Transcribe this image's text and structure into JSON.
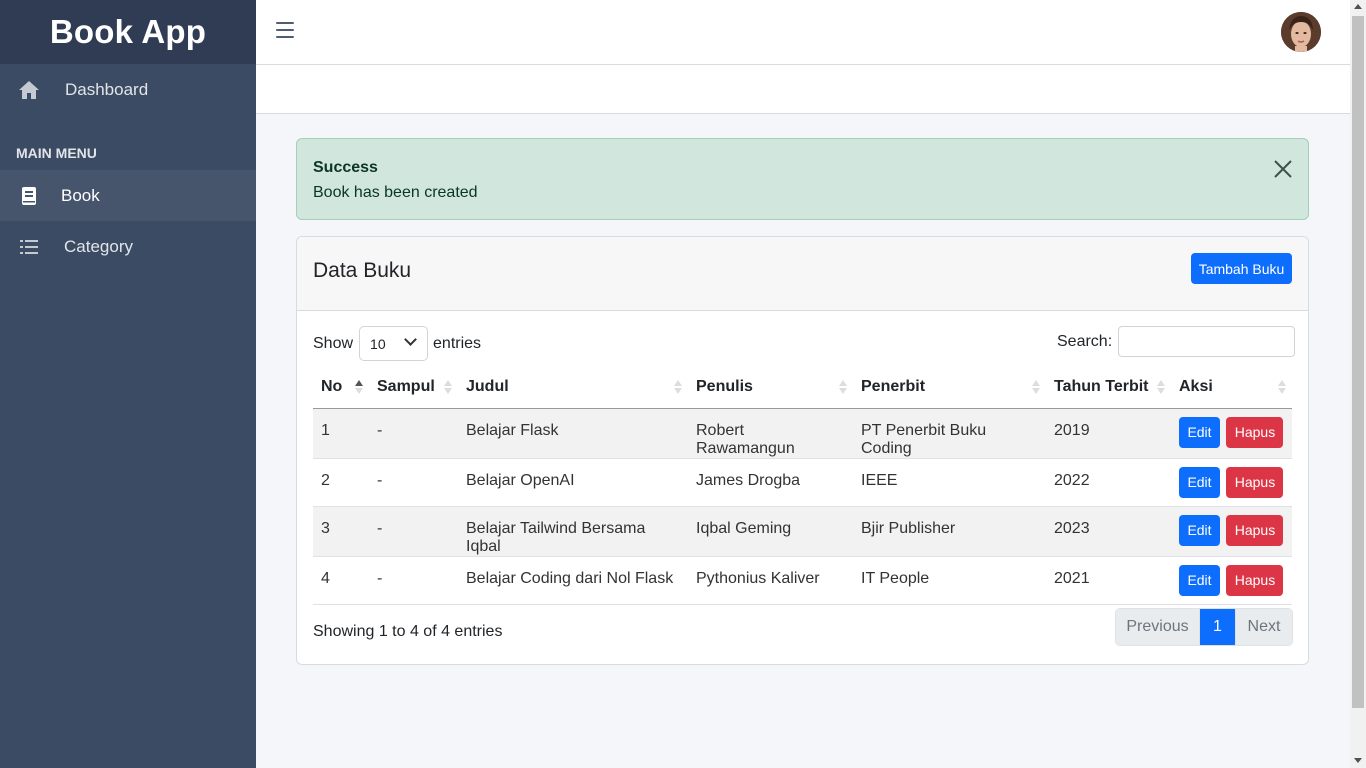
{
  "sidebar": {
    "brand": "Book App",
    "dashboard_label": "Dashboard",
    "section_title": "MAIN MENU",
    "items": [
      {
        "label": "Book",
        "icon": "book-icon",
        "active": true
      },
      {
        "label": "Category",
        "icon": "list-icon",
        "active": false
      }
    ]
  },
  "header": {
    "toggle_icon": "hamburger-icon",
    "avatar": "user-avatar"
  },
  "alert": {
    "heading": "Success",
    "message": "Book has been created",
    "close_icon": "close-icon",
    "color": "#d1e7dd"
  },
  "card": {
    "title": "Data Buku",
    "add_button": "Tambah Buku"
  },
  "datatable": {
    "show_label": "Show",
    "page_size": "10",
    "entries_label": "entries",
    "search_label": "Search:",
    "search_value": "",
    "columns": [
      "No",
      "Sampul",
      "Judul",
      "Penulis",
      "Penerbit",
      "Tahun Terbit",
      "Aksi"
    ],
    "rows": [
      {
        "no": "1",
        "sampul": "-",
        "judul": "Belajar Flask",
        "penulis": "Robert Rawamangun",
        "penerbit": "PT Penerbit Buku Coding",
        "tahun": "2019"
      },
      {
        "no": "2",
        "sampul": "-",
        "judul": "Belajar OpenAI",
        "penulis": "James Drogba",
        "penerbit": "IEEE",
        "tahun": "2022"
      },
      {
        "no": "3",
        "sampul": "-",
        "judul": "Belajar Tailwind Bersama Iqbal",
        "penulis": "Iqbal Geming",
        "penerbit": "Bjir Publisher",
        "tahun": "2023"
      },
      {
        "no": "4",
        "sampul": "-",
        "judul": "Belajar Coding dari Nol Flask",
        "penulis": "Pythonius Kaliver",
        "penerbit": "IT People",
        "tahun": "2021"
      }
    ],
    "edit_label": "Edit",
    "delete_label": "Hapus",
    "info": "Showing 1 to 4 of 4 entries",
    "pagination": {
      "previous": "Previous",
      "current": "1",
      "next": "Next"
    }
  },
  "colors": {
    "sidebar_bg": "#3c4b64",
    "brand_bg": "#303c54",
    "primary": "#0d6efd",
    "danger": "#dc3545"
  }
}
